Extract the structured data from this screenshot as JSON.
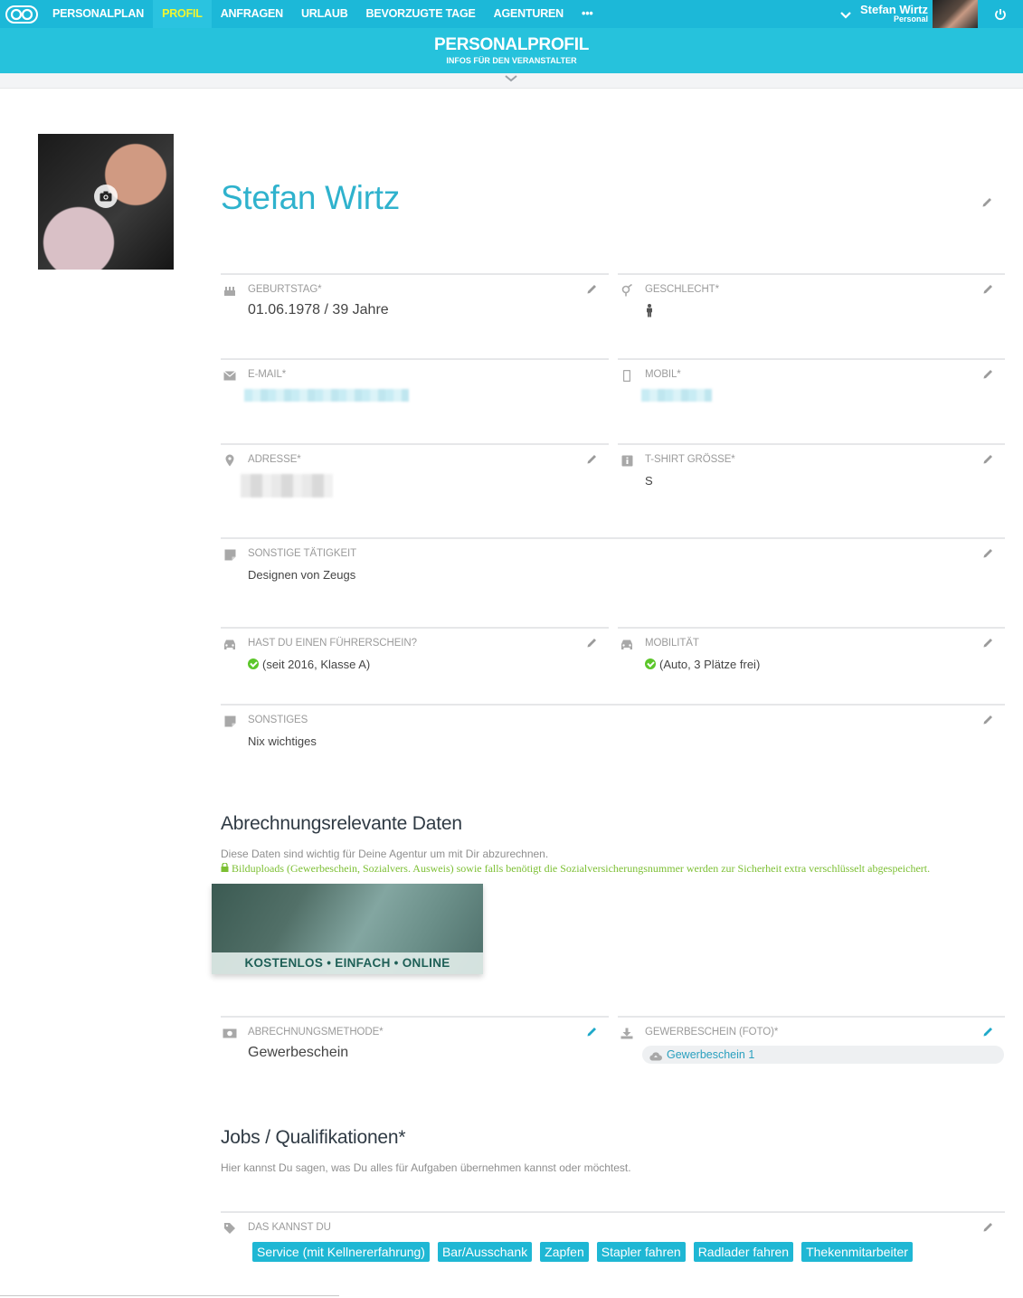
{
  "nav": {
    "items": [
      {
        "label": "PERSONALPLAN",
        "active": false
      },
      {
        "label": "PROFIL",
        "active": true
      },
      {
        "label": "ANFRAGEN",
        "active": false
      },
      {
        "label": "URLAUB",
        "active": false
      },
      {
        "label": "BEVORZUGTE TAGE",
        "active": false
      },
      {
        "label": "AGENTUREN",
        "active": false
      },
      {
        "label": "•••",
        "active": false
      }
    ],
    "user_name": "Stefan Wirtz",
    "user_role": "Personal"
  },
  "header": {
    "title": "PERSONALPROFIL",
    "subtitle": "INFOS FÜR DEN VERANSTALTER"
  },
  "profile": {
    "name": "Stefan Wirtz"
  },
  "fields": {
    "birthday": {
      "label": "GEBURTSTAG*",
      "value": "01.06.1978 / 39 Jahre"
    },
    "gender": {
      "label": "GESCHLECHT*"
    },
    "email": {
      "label": "E-MAIL*"
    },
    "mobile": {
      "label": "MOBIL*"
    },
    "address": {
      "label": "ADRESSE*"
    },
    "shirt": {
      "label": "T-SHIRT GRÖSSE*",
      "value": "S"
    },
    "other_job": {
      "label": "SONSTIGE TÄTIGKEIT",
      "value": "Designen von Zeugs"
    },
    "license": {
      "label": "HAST DU EINEN FÜHRERSCHEIN?",
      "value": "(seit 2016, Klasse A)"
    },
    "mobility": {
      "label": "MOBILITÄT",
      "value": "(Auto, 3 Plätze frei)"
    },
    "misc": {
      "label": "SONSTIGES",
      "value": "Nix wichtiges"
    }
  },
  "billing": {
    "title": "Abrechnungsrelevante Daten",
    "desc": "Diese Daten sind wichtig für Deine Agentur um mit Dir abzurechnen.",
    "security_note": "Bilduploads (Gewerbeschein, Sozialvers. Ausweis) sowie falls benötigt die Sozialversicherungsnummer werden zur Sicherheit extra verschlüsselt abgespeichert.",
    "banner_text": "KOSTENLOS • EINFACH • ONLINE",
    "method": {
      "label": "ABRECHNUNGSMETHODE*",
      "value": "Gewerbeschein"
    },
    "license_photo": {
      "label": "GEWERBESCHEIN (FOTO)*",
      "file": "Gewerbeschein 1"
    }
  },
  "jobs": {
    "title": "Jobs / Qualifikationen*",
    "desc": "Hier kannst Du sagen, was Du alles für Aufgaben übernehmen kannst oder möchtest.",
    "skills_label": "DAS KANNST DU",
    "tags": [
      "Service (mit Kellnererfahrung)",
      "Bar/Ausschank",
      "Zapfen",
      "Stapler fahren",
      "Radlader fahren",
      "Thekenmitarbeiter"
    ]
  },
  "colors": {
    "accent": "#1cb8d8",
    "active_nav": "#f1f530",
    "name": "#2fb2cd",
    "success": "#5cc62a"
  }
}
